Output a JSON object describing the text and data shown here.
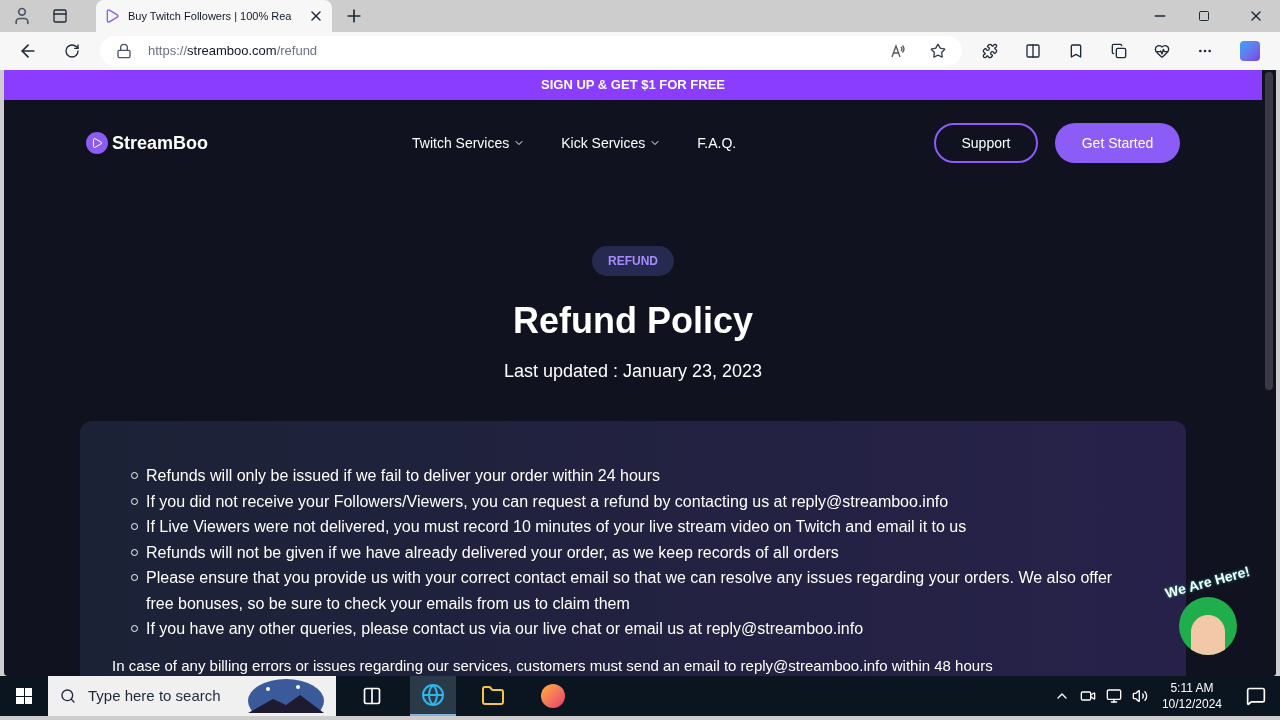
{
  "browser": {
    "tab_title": "Buy Twitch Followers | 100% Rea",
    "url_prefix": "https://",
    "url_host": "streamboo.com",
    "url_path": "/refund"
  },
  "promo_bar": {
    "text": "SIGN UP & GET $1 FOR FREE"
  },
  "nav": {
    "logo": "StreamBoo",
    "links": [
      {
        "label": "Twitch Services",
        "dropdown": true
      },
      {
        "label": "Kick Services",
        "dropdown": true
      },
      {
        "label": "F.A.Q.",
        "dropdown": false
      }
    ],
    "buttons": [
      {
        "label": "Support",
        "kind": "outline"
      },
      {
        "label": "Get Started",
        "kind": "filled"
      }
    ]
  },
  "hero": {
    "badge": "REFUND",
    "title": "Refund Policy",
    "updated": "Last updated : January 23, 2023"
  },
  "policy": {
    "items": [
      "Refunds will only be issued if we fail to deliver your order within 24 hours",
      "If you did not receive your Followers/Viewers, you can request a refund by contacting us at reply@streamboo.info",
      "If Live Viewers were not delivered, you must record 10 minutes of your live stream video on Twitch and email it to us",
      "Refunds will not be given if we have already delivered your order, as we keep records of all orders",
      "Please ensure that you provide us with your correct contact email so that we can resolve any issues regarding your orders. We also offer free bonuses, so be sure to check your emails from us to claim them",
      "If you have any other queries, please contact us via our live chat or email us at reply@streamboo.info"
    ],
    "paragraph": "In case of any billing errors or issues regarding our services, customers must send an email to reply@streamboo.info within 48 hours"
  },
  "chat_widget": {
    "label": "We Are Here!"
  },
  "taskbar": {
    "search_placeholder": "Type here to search",
    "time": "5:11 AM",
    "date": "10/12/2024"
  }
}
